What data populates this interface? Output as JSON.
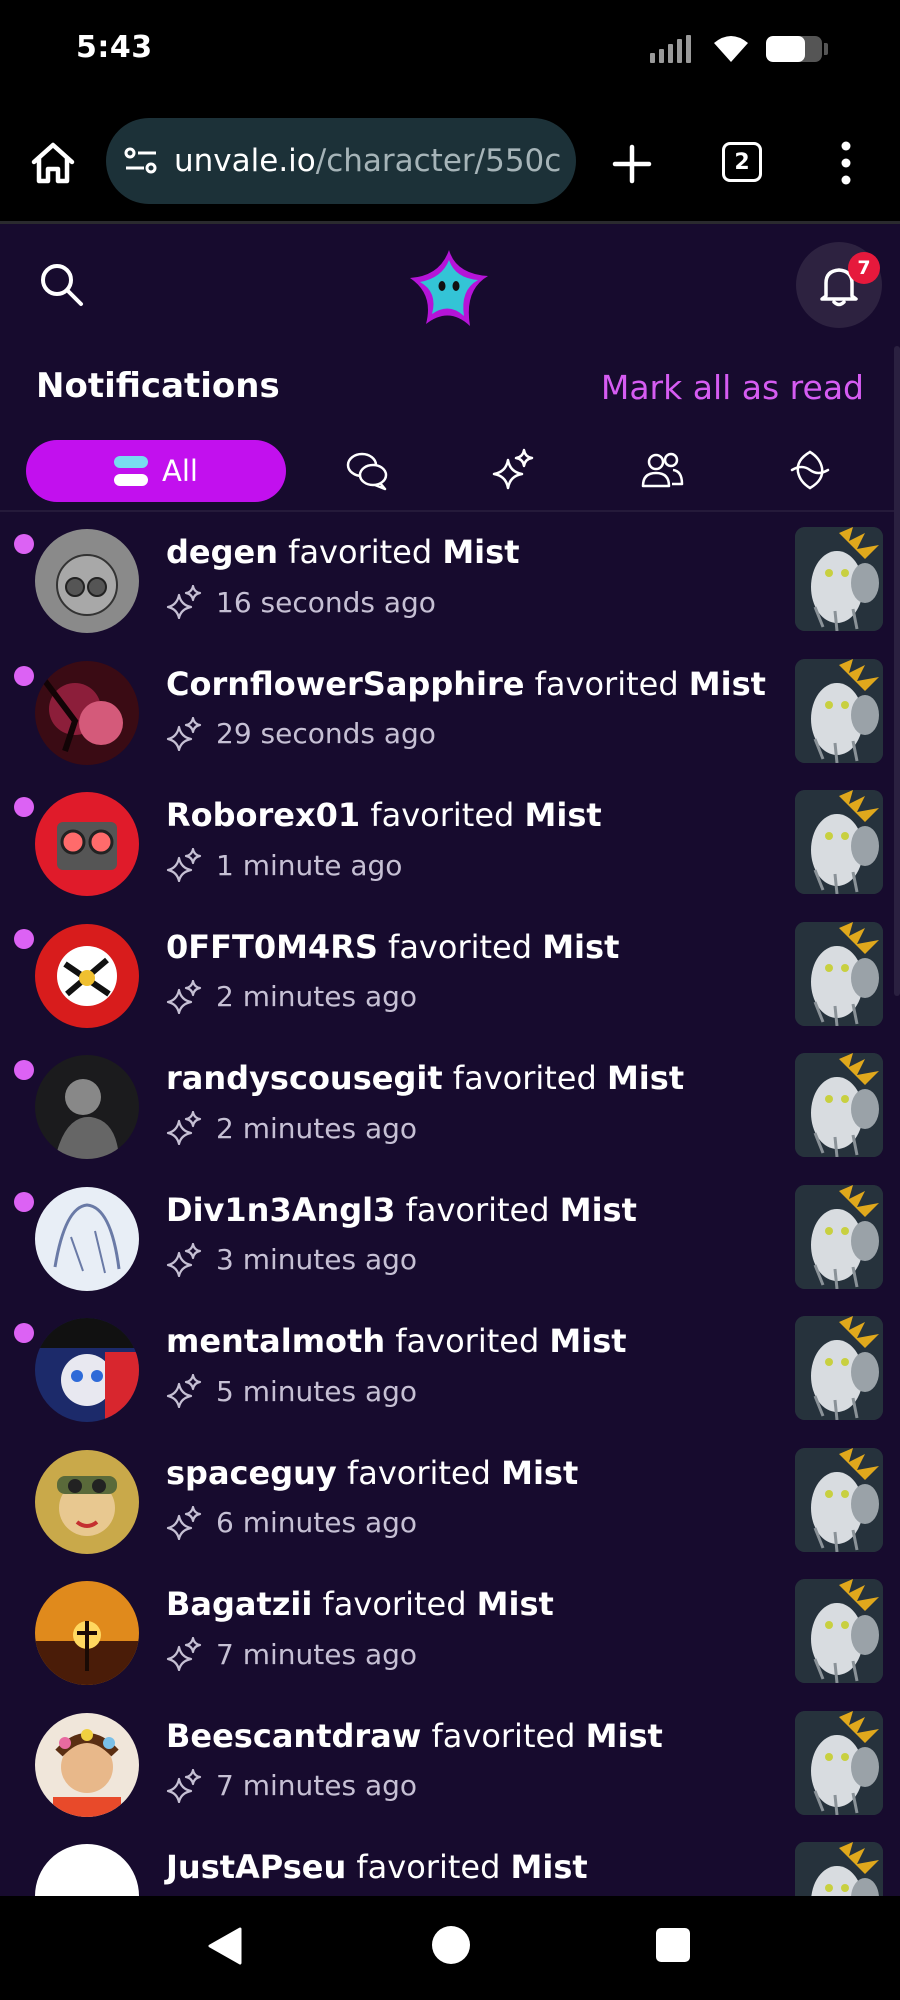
{
  "status_bar": {
    "time": "5:43",
    "battery_level": 0.7
  },
  "browser": {
    "url_host": "unvale.io",
    "url_path": "/character/550c",
    "tab_count": "2"
  },
  "header": {
    "badge_count": "7"
  },
  "notifications": {
    "title": "Notifications",
    "mark_all_label": "Mark all as read",
    "tabs": [
      {
        "label": "All",
        "icon": "all-icon",
        "active": true
      },
      {
        "label": "",
        "icon": "chat-icon"
      },
      {
        "label": "",
        "icon": "sparkles-icon"
      },
      {
        "label": "",
        "icon": "users-icon"
      },
      {
        "label": "",
        "icon": "swirl-icon"
      }
    ],
    "items": [
      {
        "user": "degen",
        "action": "favorited",
        "target": "Mist",
        "time": "16 seconds ago",
        "unread": true
      },
      {
        "user": "CornflowerSapphire",
        "action": "favorited",
        "target": "Mist",
        "time": "29 seconds ago",
        "unread": true
      },
      {
        "user": "Roborex01",
        "action": "favorited",
        "target": "Mist",
        "time": "1 minute ago",
        "unread": true
      },
      {
        "user": "0FFT0M4RS",
        "action": "favorited",
        "target": "Mist",
        "time": "2 minutes ago",
        "unread": true
      },
      {
        "user": "randyscousegit",
        "action": "favorited",
        "target": "Mist",
        "time": "2 minutes ago",
        "unread": true
      },
      {
        "user": "Div1n3Angl3",
        "action": "favorited",
        "target": "Mist",
        "time": "3 minutes ago",
        "unread": true
      },
      {
        "user": "mentalmoth",
        "action": "favorited",
        "target": "Mist",
        "time": "5 minutes ago",
        "unread": true
      },
      {
        "user": "spaceguy",
        "action": "favorited",
        "target": "Mist",
        "time": "6 minutes ago",
        "unread": false
      },
      {
        "user": "Bagatzii",
        "action": "favorited",
        "target": "Mist",
        "time": "7 minutes ago",
        "unread": false
      },
      {
        "user": "Beescantdraw",
        "action": "favorited",
        "target": "Mist",
        "time": "7 minutes ago",
        "unread": false
      },
      {
        "user": "JustAPseu",
        "action": "favorited",
        "target": "Mist",
        "time": "",
        "unread": false
      }
    ]
  },
  "colors": {
    "background": "#170b2e",
    "accent": "#c210ee",
    "link": "#d65cf2",
    "unread_dot": "#dc62f4",
    "badge": "#e6193c"
  }
}
